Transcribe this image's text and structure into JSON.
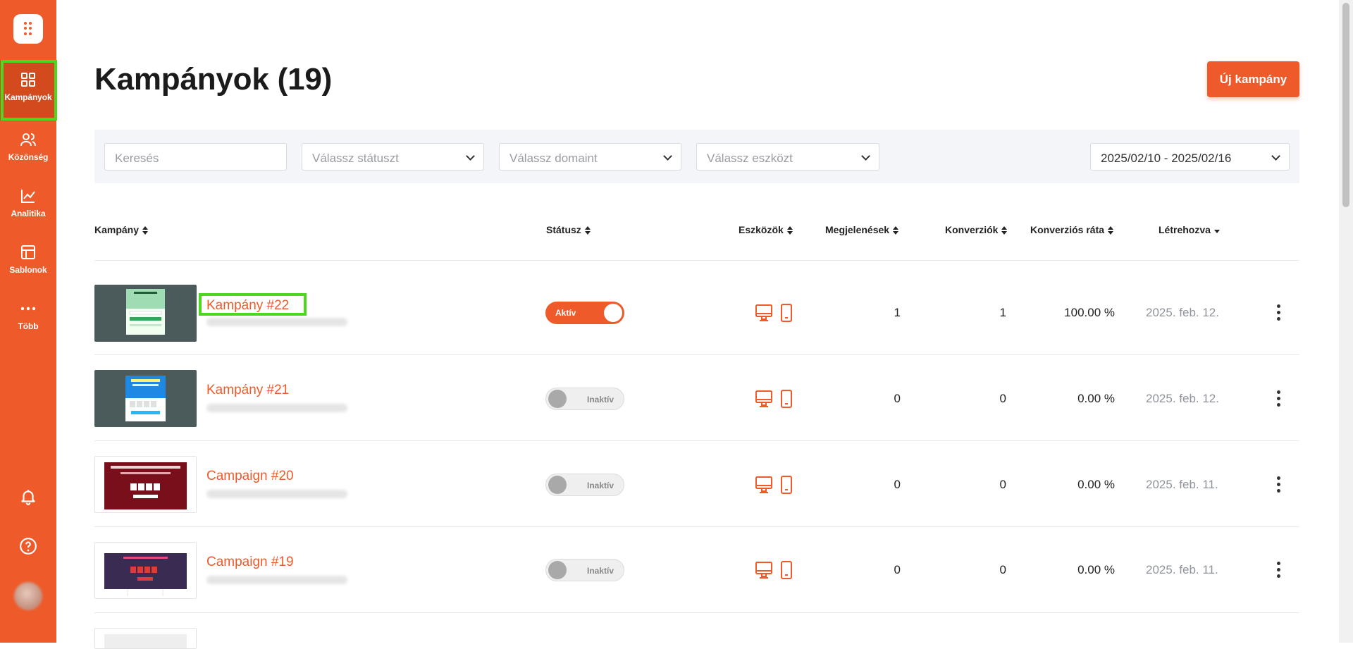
{
  "sidebar": {
    "items": [
      {
        "label": "Kampányok",
        "icon": "grid-icon"
      },
      {
        "label": "Közönség",
        "icon": "users-icon"
      },
      {
        "label": "Analitika",
        "icon": "chart-line-icon"
      },
      {
        "label": "Sablonok",
        "icon": "layout-icon"
      },
      {
        "label": "Több",
        "icon": "more-dots-icon"
      }
    ]
  },
  "header": {
    "title": "Kampányok (19)",
    "new_button": "Új kampány"
  },
  "filters": {
    "search_placeholder": "Keresés",
    "status_placeholder": "Válassz státuszt",
    "domain_placeholder": "Válassz domaint",
    "device_placeholder": "Válassz eszközt",
    "date_range": "2025/02/10 - 2025/02/16"
  },
  "table": {
    "columns": [
      "Kampány",
      "Státusz",
      "Eszközök",
      "Megjelenések",
      "Konverziók",
      "Konverziós ráta",
      "Létrehozva"
    ],
    "rows": [
      {
        "name": "Kampány #22",
        "status": "Aktív",
        "active": true,
        "impressions": "1",
        "conversions": "1",
        "rate": "100.00 %",
        "created": "2025. feb. 12.",
        "thumb_text": "Free $100 gift card"
      },
      {
        "name": "Kampány #21",
        "status": "Inaktív",
        "active": false,
        "impressions": "0",
        "conversions": "0",
        "rate": "0.00 %",
        "created": "2025. feb. 12.",
        "thumb_text": "10% OFF & FREE SHIPPING"
      },
      {
        "name": "Campaign #20",
        "status": "Inaktív",
        "active": false,
        "impressions": "0",
        "conversions": "0",
        "rate": "0.00 %",
        "created": "2025. feb. 11.",
        "thumb_text": "Valentine's Day Sale Today Only!"
      },
      {
        "name": "Campaign #19",
        "status": "Inaktív",
        "active": false,
        "impressions": "0",
        "conversions": "0",
        "rate": "0.00 %",
        "created": "2025. feb. 11.",
        "thumb_text": ""
      }
    ]
  },
  "colors": {
    "accent": "#ef5a2a",
    "highlight": "#4cd81f"
  }
}
